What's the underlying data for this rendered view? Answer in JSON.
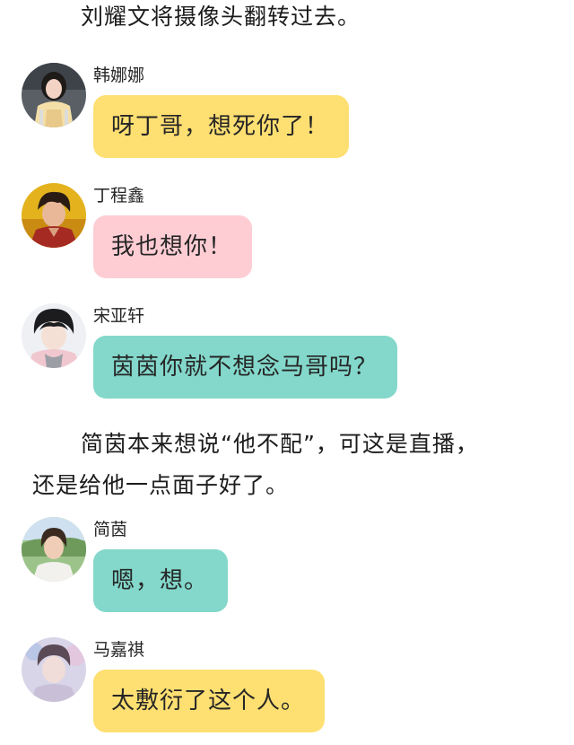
{
  "narration": {
    "line1": "刘耀文将摄像头翻转过去。",
    "paragraph2": "简茵本来想说“他不配”，可这是直播，还是给他一点面子好了。",
    "line2a": "简茵本来想说“他不配”，可这是直播，",
    "line2b": "还是给他一点面子好了。"
  },
  "messages": [
    {
      "sender": "韩娜娜",
      "text": "呀丁哥，想死你了！",
      "color": "#fedf72"
    },
    {
      "sender": "丁程鑫",
      "text": "我也想你！",
      "color": "#fecdd4"
    },
    {
      "sender": "宋亚轩",
      "text": "茵茵你就不想念马哥吗？",
      "color": "#83d8cb"
    },
    {
      "sender": "简茵",
      "text": "嗯，想。",
      "color": "#83d8cb"
    },
    {
      "sender": "马嘉祺",
      "text": "太敷衍了这个人。",
      "color": "#fedf72"
    }
  ]
}
